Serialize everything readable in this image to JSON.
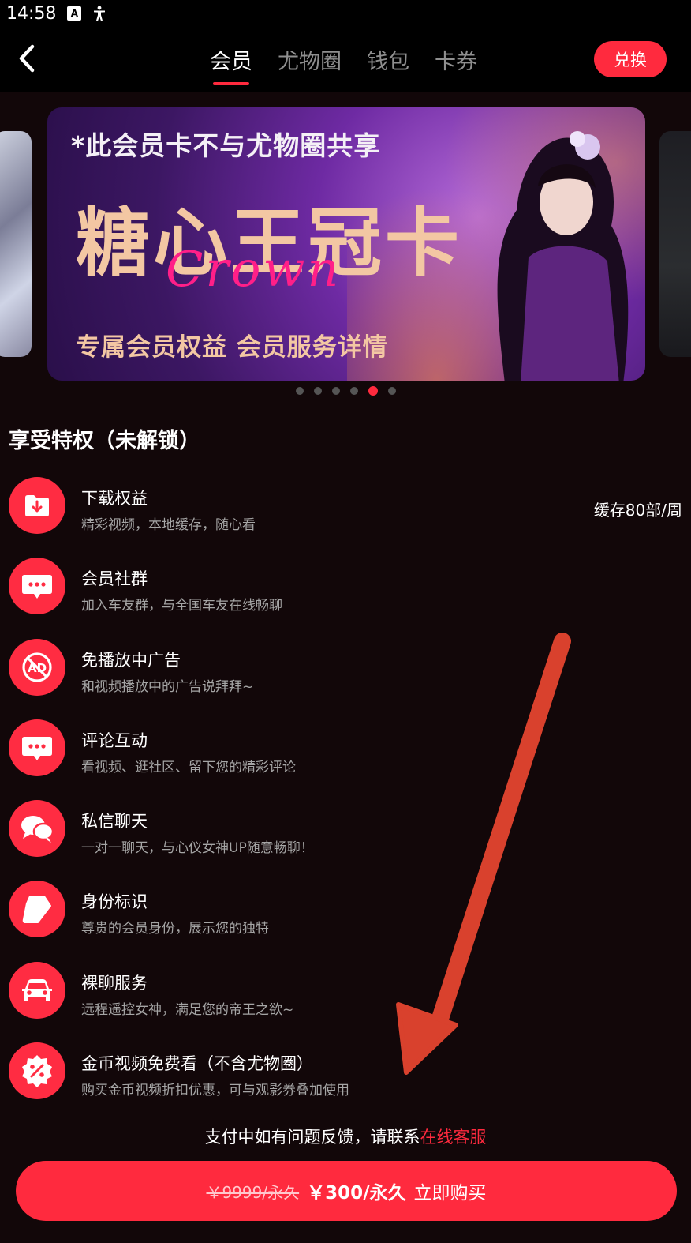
{
  "status_bar": {
    "time": "14:58",
    "icons": [
      "a-notification-icon",
      "accessibility-icon"
    ]
  },
  "nav": {
    "tabs": [
      {
        "label": "会员",
        "active": true
      },
      {
        "label": "尤物圈",
        "active": false
      },
      {
        "label": "钱包",
        "active": false
      },
      {
        "label": "卡券",
        "active": false
      }
    ],
    "exchange_label": "兑换"
  },
  "banner": {
    "notice": "*此会员卡不与尤物圈共享",
    "title": "糖心王冠卡",
    "script": "Crown",
    "subtitle": "专属会员权益  会员服务详情",
    "slide_count": 6,
    "active_slide": 4
  },
  "section_title": "享受特权（未解锁）",
  "perks": [
    {
      "icon": "download-folder-icon",
      "title": "下载权益",
      "desc": "精彩视频，本地缓存，随心看",
      "extra": "缓存80部/周"
    },
    {
      "icon": "chat-bubble-icon",
      "title": "会员社群",
      "desc": "加入车友群，与全国车友在线畅聊"
    },
    {
      "icon": "no-ads-icon",
      "title": "免播放中广告",
      "desc": "和视频播放中的广告说拜拜~"
    },
    {
      "icon": "comment-icon",
      "title": "评论互动",
      "desc": "看视频、逛社区、留下您的精彩评论"
    },
    {
      "icon": "private-message-icon",
      "title": "私信聊天",
      "desc": "一对一聊天，与心仪女神UP随意畅聊！"
    },
    {
      "icon": "identity-badge-icon",
      "title": "身份标识",
      "desc": "尊贵的会员身份，展示您的独特"
    },
    {
      "icon": "car-icon",
      "title": "裸聊服务",
      "desc": "远程遥控女神，满足您的帝王之欲~"
    },
    {
      "icon": "discount-badge-icon",
      "title": "金币视频免费看（不含尤物圈）",
      "desc": "购买金币视频折扣优惠，可与观影券叠加使用"
    }
  ],
  "contact": {
    "text": "支付中如有问题反馈，请联系",
    "link": "在线客服"
  },
  "buy": {
    "old_price": "￥9999/永久",
    "new_price": "￥300/永久",
    "label": "立即购买"
  },
  "colors": {
    "accent": "#ff2a3e",
    "background": "#120709",
    "annotation_arrow": "#d9412d"
  }
}
